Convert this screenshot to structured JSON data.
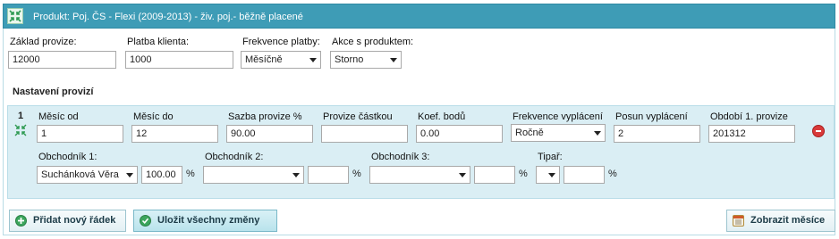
{
  "title": "Produkt: Poj. ČS - Flexi (2009-2013) - živ. poj.- běžně placené",
  "top_fields": {
    "zaklad_label": "Základ provize:",
    "zaklad_value": "12000",
    "platba_label": "Platba klienta:",
    "platba_value": "1000",
    "frekvence_label": "Frekvence platby:",
    "frekvence_value": "Měsíčně",
    "akce_label": "Akce s produktem:",
    "akce_value": "Storno"
  },
  "section_title": "Nastavení provizí",
  "row": {
    "number": "1",
    "labels": {
      "mesic_od": "Měsíc od",
      "mesic_do": "Měsíc do",
      "sazba": "Sazba provize %",
      "castka": "Provize částkou",
      "koef": "Koef. bodů",
      "frekvence": "Frekvence vyplácení",
      "posun": "Posun vyplácení",
      "obdobi": "Období 1. provize"
    },
    "values": {
      "mesic_od": "1",
      "mesic_do": "12",
      "sazba": "90.00",
      "castka": "",
      "koef": "0.00",
      "frekvence": "Ročně",
      "posun": "2",
      "obdobi": "201312"
    },
    "obchodnik1_label": "Obchodník 1:",
    "obchodnik1_value": "Suchánková Věra",
    "obchodnik1_pct": "100.00",
    "obchodnik2_label": "Obchodník 2:",
    "obchodnik2_value": "",
    "obchodnik2_pct": "",
    "obchodnik3_label": "Obchodník 3:",
    "obchodnik3_value": "",
    "obchodnik3_pct": "",
    "tipar_label": "Tipař:",
    "tipar_value": "",
    "tipar_pct": "",
    "pct_sign": "%"
  },
  "buttons": {
    "add_row": "Přidat nový řádek",
    "save_all": "Uložit všechny změny",
    "show_months": "Zobrazit měsíce"
  },
  "colors": {
    "title_bar": "#3e9cb6",
    "row_bg": "#daeef4",
    "delete_icon": "#d83a3a"
  }
}
